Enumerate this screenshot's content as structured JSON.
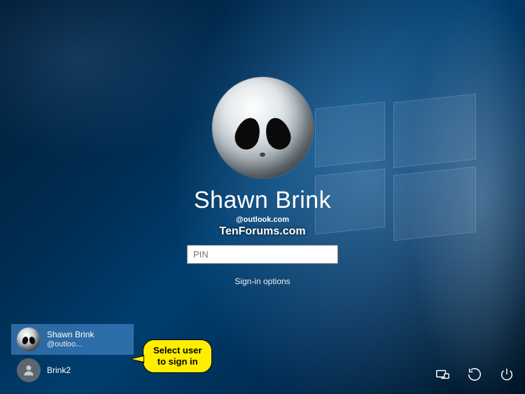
{
  "selected_user": {
    "display_name": "Shawn Brink",
    "email_partial": "@outlook.com"
  },
  "watermark": "TenForums.com",
  "pin_field": {
    "placeholder": "PIN",
    "value": ""
  },
  "signin_options_label": "Sign-in options",
  "user_list": [
    {
      "name": "Shawn Brink",
      "sub": "@outloo...",
      "avatar": "alien",
      "selected": true
    },
    {
      "name": "Brink2",
      "sub": "",
      "avatar": "generic",
      "selected": false
    }
  ],
  "callout": {
    "line1": "Select user",
    "line2": "to sign in"
  },
  "tray_icons": {
    "network": "network-icon",
    "ease_of_access": "ease-of-access-icon",
    "power": "power-icon"
  }
}
